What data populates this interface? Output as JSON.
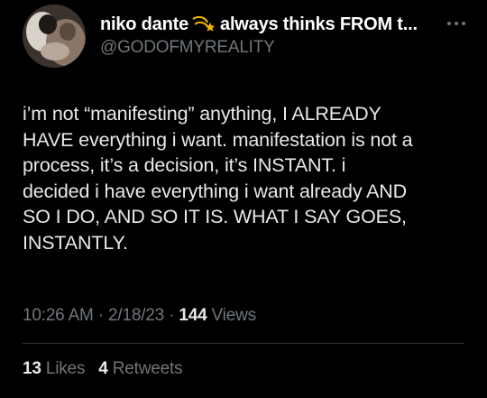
{
  "author": {
    "display_name": "niko dante",
    "bio_emoji": "dizzy-comet-emoji",
    "name_suffix": "always thinks FROM t...",
    "handle": "@GODOFMYREALITY"
  },
  "tweet": {
    "lines": [
      "i’m not “manifesting” anything, I ALREADY",
      "HAVE everything i want. manifestation is not a",
      "process, it’s a decision, it’s INSTANT. i",
      "decided i have everything i want already AND",
      "SO I DO, AND SO IT IS. WHAT I SAY GOES,",
      "INSTANTLY."
    ]
  },
  "meta": {
    "time": "10:26 AM",
    "separator": "·",
    "date": "2/18/23",
    "views_count": "144",
    "views_label": "Views"
  },
  "stats": {
    "likes_count": "13",
    "likes_label": "Likes",
    "retweets_count": "4",
    "retweets_label": "Retweets"
  },
  "colors": {
    "background": "#000000",
    "primary_text": "#e7e9ea",
    "secondary_text": "#71767b",
    "divider": "#2f3336",
    "emoji_gold": "#f4b400"
  }
}
